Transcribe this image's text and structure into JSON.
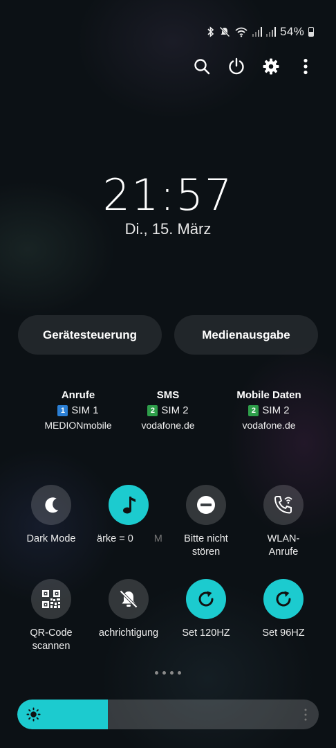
{
  "status_bar": {
    "battery_percent": "54%",
    "battery_level": 0.54,
    "icons": [
      "bluetooth-icon",
      "mute-icon",
      "wifi-icon",
      "signal-sim1-icon",
      "signal-sim2-icon",
      "battery-icon"
    ]
  },
  "top_actions": [
    "search-icon",
    "power-icon",
    "settings-gear-icon",
    "more-vert-icon"
  ],
  "lock": {
    "time": "21:57",
    "date": "Di., 15. März"
  },
  "pills": {
    "left": "Gerätesteuerung",
    "right": "Medienausgabe"
  },
  "sim": [
    {
      "title": "Anrufe",
      "num": "1",
      "sim": "SIM 1",
      "carrier": "MEDIONmobile",
      "color": "#2b7fd4"
    },
    {
      "title": "SMS",
      "num": "2",
      "sim": "SIM 2",
      "carrier": "vodafone.de",
      "color": "#2e9e4a"
    },
    {
      "title": "Mobile Daten",
      "num": "2",
      "sim": "SIM 2",
      "carrier": "vodafone.de",
      "color": "#2e9e4a"
    }
  ],
  "tiles": [
    {
      "label1": "Dark Mode",
      "label2": "",
      "icon": "moon-icon",
      "active": false
    },
    {
      "label1": "ärke = 0",
      "label2": "",
      "icon": "music-note-icon",
      "active": true
    },
    {
      "label1": "Bitte nicht",
      "label2": "stören",
      "icon": "do-not-disturb-icon",
      "active": false
    },
    {
      "label1": "WLAN-",
      "label2": "Anrufe",
      "icon": "wifi-calling-icon",
      "active": false
    },
    {
      "label1": "QR-Code",
      "label2": "scannen",
      "icon": "qr-code-icon",
      "active": false
    },
    {
      "label1": "achrichtigung",
      "label2": "",
      "icon": "notification-off-icon",
      "active": false
    },
    {
      "label1": "Set 120HZ",
      "label2": "",
      "icon": "refresh-icon",
      "active": true
    },
    {
      "label1": "Set 96HZ",
      "label2": "",
      "icon": "refresh-icon",
      "active": true
    }
  ],
  "page_dots": 4,
  "brightness_level": 0.3,
  "colors": {
    "accent": "#1ccbcf",
    "background": "#0c1115"
  }
}
